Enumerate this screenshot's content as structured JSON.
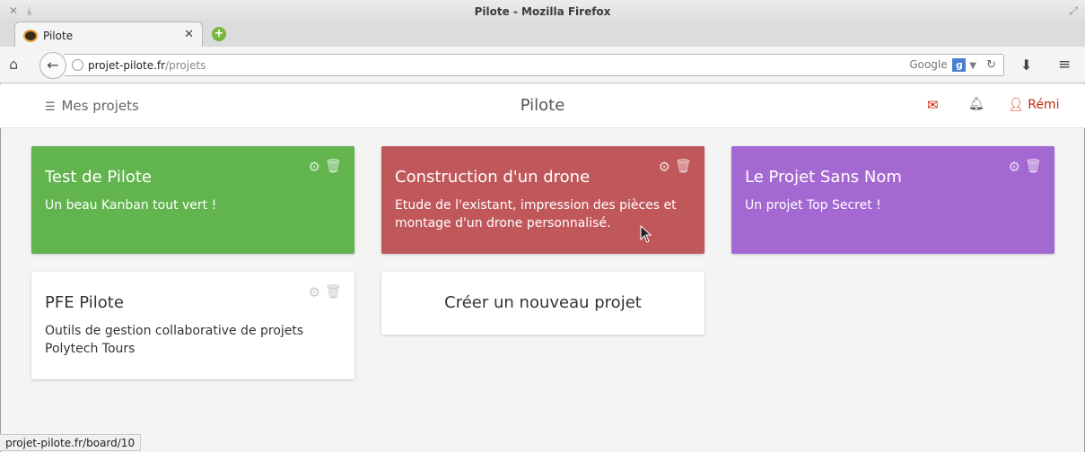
{
  "window": {
    "title": "Pilote - Mozilla Firefox"
  },
  "browser": {
    "tab_title": "Pilote",
    "url_host": "projet-pilote.fr",
    "url_path": "/projets",
    "search_engine": "Google",
    "status_url": "projet-pilote.fr/board/10"
  },
  "header": {
    "projects_label": "Mes projets",
    "brand": "Pilote",
    "user_name": "Rémi"
  },
  "projects": [
    {
      "title": "Test de Pilote",
      "description": "Un beau Kanban tout vert !",
      "color": "#62b44f"
    },
    {
      "title": "Construction d'un drone",
      "description": "Etude de l'existant, impression des pièces et montage d'un drone personnalisé.",
      "color": "#c0575a"
    },
    {
      "title": "Le Projet Sans Nom",
      "description": "Un projet Top Secret !",
      "color": "#a468d2"
    },
    {
      "title": "PFE Pilote",
      "description": "Outils de gestion collaborative de projets Polytech Tours",
      "color": "#ffffff"
    }
  ],
  "new_project_label": "Créer un nouveau projet",
  "accent": "#c62a0d"
}
